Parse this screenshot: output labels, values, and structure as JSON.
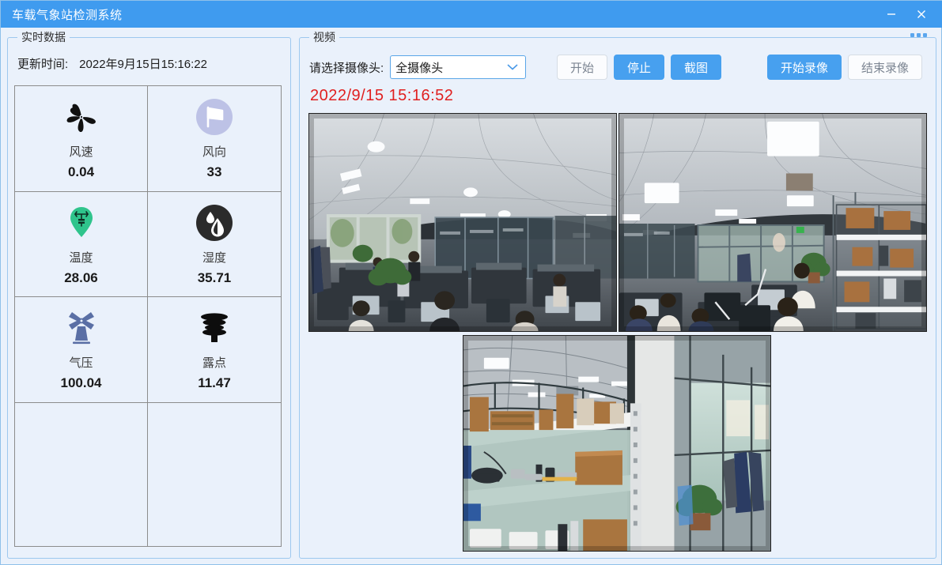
{
  "window": {
    "title": "车载气象站检测系统",
    "minimize_icon": "minimize-icon",
    "close_icon": "close-icon",
    "titlebar_color": "#3f9bef"
  },
  "left_panel": {
    "legend": "实时数据",
    "update_label": "更新时间:",
    "update_value": "2022年9月15日15:16:22",
    "metrics": [
      {
        "icon": "fan-icon",
        "name": "风速",
        "value": "0.04",
        "icon_color": "#111111"
      },
      {
        "icon": "wind-flag-icon",
        "name": "风向",
        "value": "33",
        "icon_color": "#b9bfe4"
      },
      {
        "icon": "thermometer-pin-icon",
        "name": "温度",
        "value": "28.06",
        "icon_color": "#2fc48c"
      },
      {
        "icon": "humidity-drop-icon",
        "name": "湿度",
        "value": "35.71",
        "icon_color": "#2b2b2b"
      },
      {
        "icon": "windmill-icon",
        "name": "气压",
        "value": "100.04",
        "icon_color": "#5a6fa5"
      },
      {
        "icon": "dewpoint-shield-icon",
        "name": "露点",
        "value": "11.47",
        "icon_color": "#0d0d0d"
      }
    ]
  },
  "video_panel": {
    "legend": "视频",
    "camera_label": "请选择摄像头:",
    "camera_selected": "全摄像头",
    "camera_options": [
      "全摄像头"
    ],
    "dropdown_icon": "chevron-down-icon",
    "timestamp": "2022/9/15 15:16:52",
    "timestamp_color": "#e02020",
    "buttons": [
      {
        "label": "开始",
        "style": "default",
        "name": "start-button"
      },
      {
        "label": "停止",
        "style": "primary",
        "name": "stop-button"
      },
      {
        "label": "截图",
        "style": "primary",
        "name": "screenshot-button"
      }
    ],
    "record_buttons": [
      {
        "label": "开始录像",
        "style": "primary",
        "name": "start-record-button"
      },
      {
        "label": "结束录像",
        "style": "default",
        "name": "stop-record-button"
      }
    ],
    "accent_color": "#47a0ef",
    "feeds": [
      {
        "name": "camera-feed-1",
        "scene": "office-open-workspace"
      },
      {
        "name": "camera-feed-2",
        "scene": "office-with-shelving"
      },
      {
        "name": "camera-feed-3",
        "scene": "storage-shelving-area"
      }
    ]
  }
}
